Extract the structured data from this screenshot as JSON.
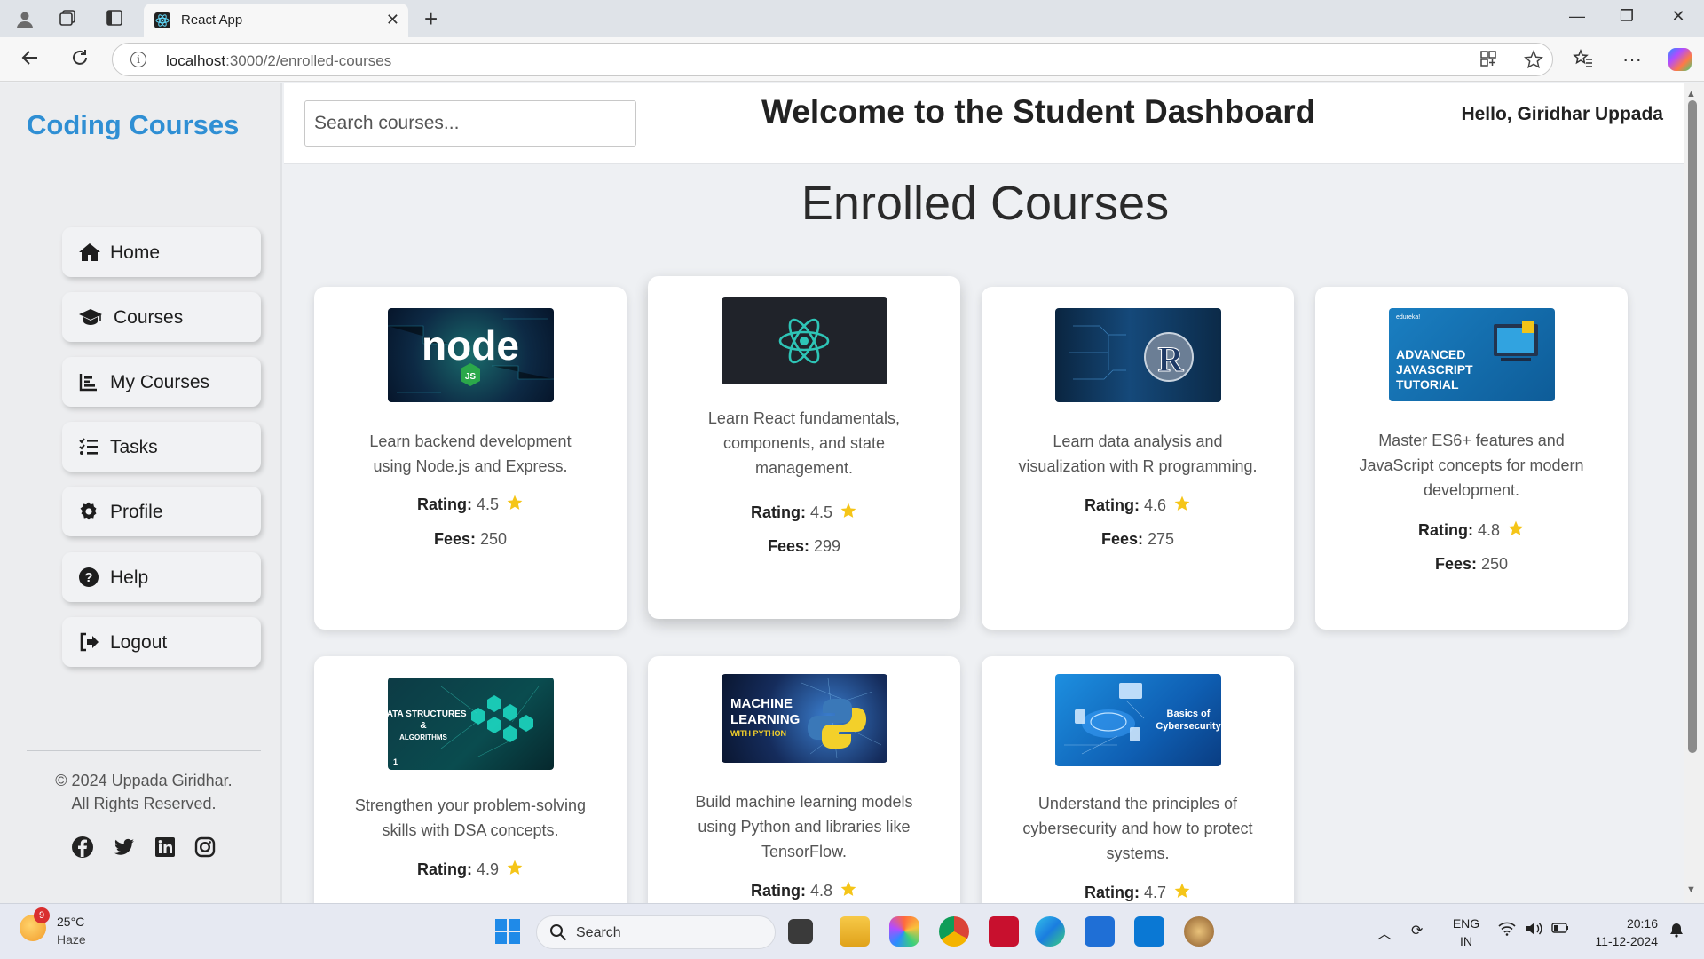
{
  "browser": {
    "tab_title": "React App",
    "url_host": "localhost",
    "url_path": ":3000/2/enrolled-courses"
  },
  "sidebar": {
    "brand": "Coding Courses",
    "items": [
      {
        "label": "Home",
        "icon": "home-icon"
      },
      {
        "label": "Courses",
        "icon": "graduation-cap-icon"
      },
      {
        "label": "My Courses",
        "icon": "bar-chart-icon"
      },
      {
        "label": "Tasks",
        "icon": "tasks-list-icon"
      },
      {
        "label": "Profile",
        "icon": "gear-icon"
      },
      {
        "label": "Help",
        "icon": "question-circle-icon"
      },
      {
        "label": "Logout",
        "icon": "logout-icon"
      }
    ],
    "copyright_line1": "© 2024 Uppada Giridhar.",
    "copyright_line2": "All Rights Reserved.",
    "social": [
      "facebook-icon",
      "twitter-icon",
      "linkedin-icon",
      "instagram-icon"
    ]
  },
  "header": {
    "search_placeholder": "Search courses...",
    "title": "Welcome to the Student Dashboard",
    "greeting": "Hello, Giridhar Uppada"
  },
  "main": {
    "heading": "Enrolled Courses",
    "rating_label": "Rating:",
    "fees_label": "Fees:",
    "courses": [
      {
        "thumb_text": "node",
        "thumb_sub": "JS",
        "description_lines": [
          "Learn backend development",
          "using Node.js and Express."
        ],
        "rating": "4.5",
        "fees": "250"
      },
      {
        "thumb_text": "",
        "thumb_sub": "",
        "description_lines": [
          "Learn React fundamentals,",
          "components, and state",
          "management."
        ],
        "rating": "4.5",
        "fees": "299"
      },
      {
        "thumb_text": "R",
        "thumb_sub": "",
        "description_lines": [
          "Learn data analysis and",
          "visualization with R programming."
        ],
        "rating": "4.6",
        "fees": "275"
      },
      {
        "thumb_text": "ADVANCED JAVASCRIPT TUTORIAL",
        "thumb_sub": "edureka!",
        "description_lines": [
          "Master ES6+ features and",
          "JavaScript concepts for modern",
          "development."
        ],
        "rating": "4.8",
        "fees": "250"
      },
      {
        "thumb_text": "DATA STRUCTURES & ALGORITHMS",
        "thumb_sub": "1",
        "description_lines": [
          "Strengthen your problem-solving",
          "skills with DSA concepts."
        ],
        "rating": "4.9",
        "fees": ""
      },
      {
        "thumb_text": "MACHINE LEARNING",
        "thumb_sub": "WITH PYTHON",
        "description_lines": [
          "Build machine learning models",
          "using Python and libraries like",
          "TensorFlow."
        ],
        "rating": "4.8",
        "fees": ""
      },
      {
        "thumb_text": "Basics of Cybersecurity",
        "thumb_sub": "",
        "description_lines": [
          "Understand the principles of",
          "cybersecurity and how to protect",
          "systems."
        ],
        "rating": "4.7",
        "fees": ""
      }
    ]
  },
  "taskbar": {
    "weather_badge": "9",
    "temperature": "25°C",
    "condition": "Haze",
    "search_label": "Search",
    "lang_line1": "ENG",
    "lang_line2": "IN",
    "time": "20:16",
    "date": "11-12-2024"
  },
  "colors": {
    "brand": "#2f8fd4",
    "star": "#f5c518",
    "card_bg": "#ffffff",
    "page_bg": "#eef0f3"
  }
}
